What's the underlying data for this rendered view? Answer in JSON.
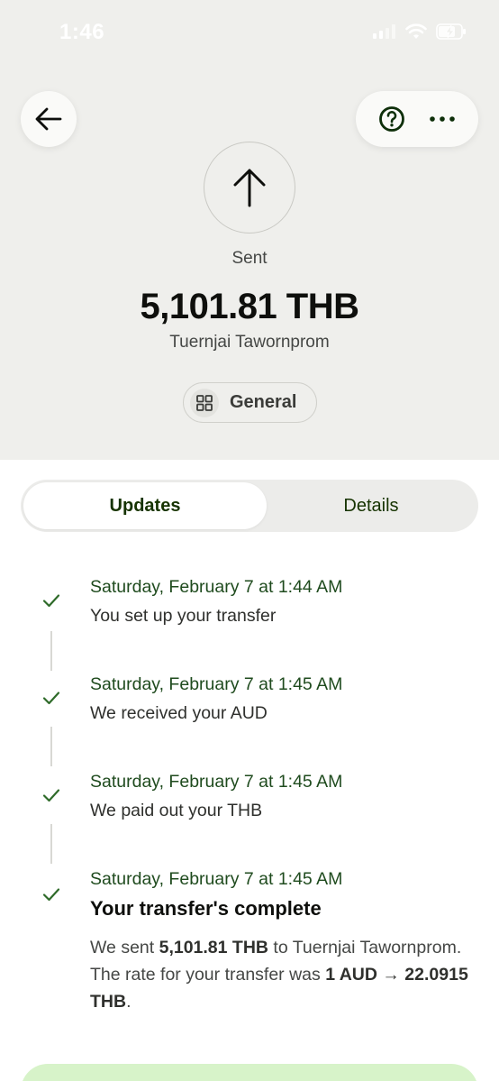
{
  "status_bar": {
    "time": "1:46"
  },
  "header": {
    "status_label": "Sent",
    "amount": "5,101.81 THB",
    "recipient": "Tuernjai Tawornprom",
    "category": "General"
  },
  "tabs": [
    {
      "label": "Updates",
      "active": true
    },
    {
      "label": "Details",
      "active": false
    }
  ],
  "timeline": [
    {
      "date": "Saturday, February 7 at 1:44 AM",
      "text": "You set up your transfer"
    },
    {
      "date": "Saturday, February 7 at 1:45 AM",
      "text": "We received your AUD"
    },
    {
      "date": "Saturday, February 7 at 1:45 AM",
      "text": "We paid out your THB"
    },
    {
      "date": "Saturday, February 7 at 1:45 AM",
      "title": "Your transfer's complete",
      "detail": {
        "p1": "We sent ",
        "amount": "5,101.81 THB",
        "p2": " to Tuernjai Tawornprom. The rate for your transfer was ",
        "rate": "1 AUD → 22.0915 THB",
        "p3": "."
      }
    }
  ],
  "colors": {
    "accent_dark_green": "#163300",
    "date_green": "#1f4b1e",
    "check_green": "#2f6b2a",
    "header_bg": "#efefec",
    "primary_button": "#d7f3c9"
  }
}
